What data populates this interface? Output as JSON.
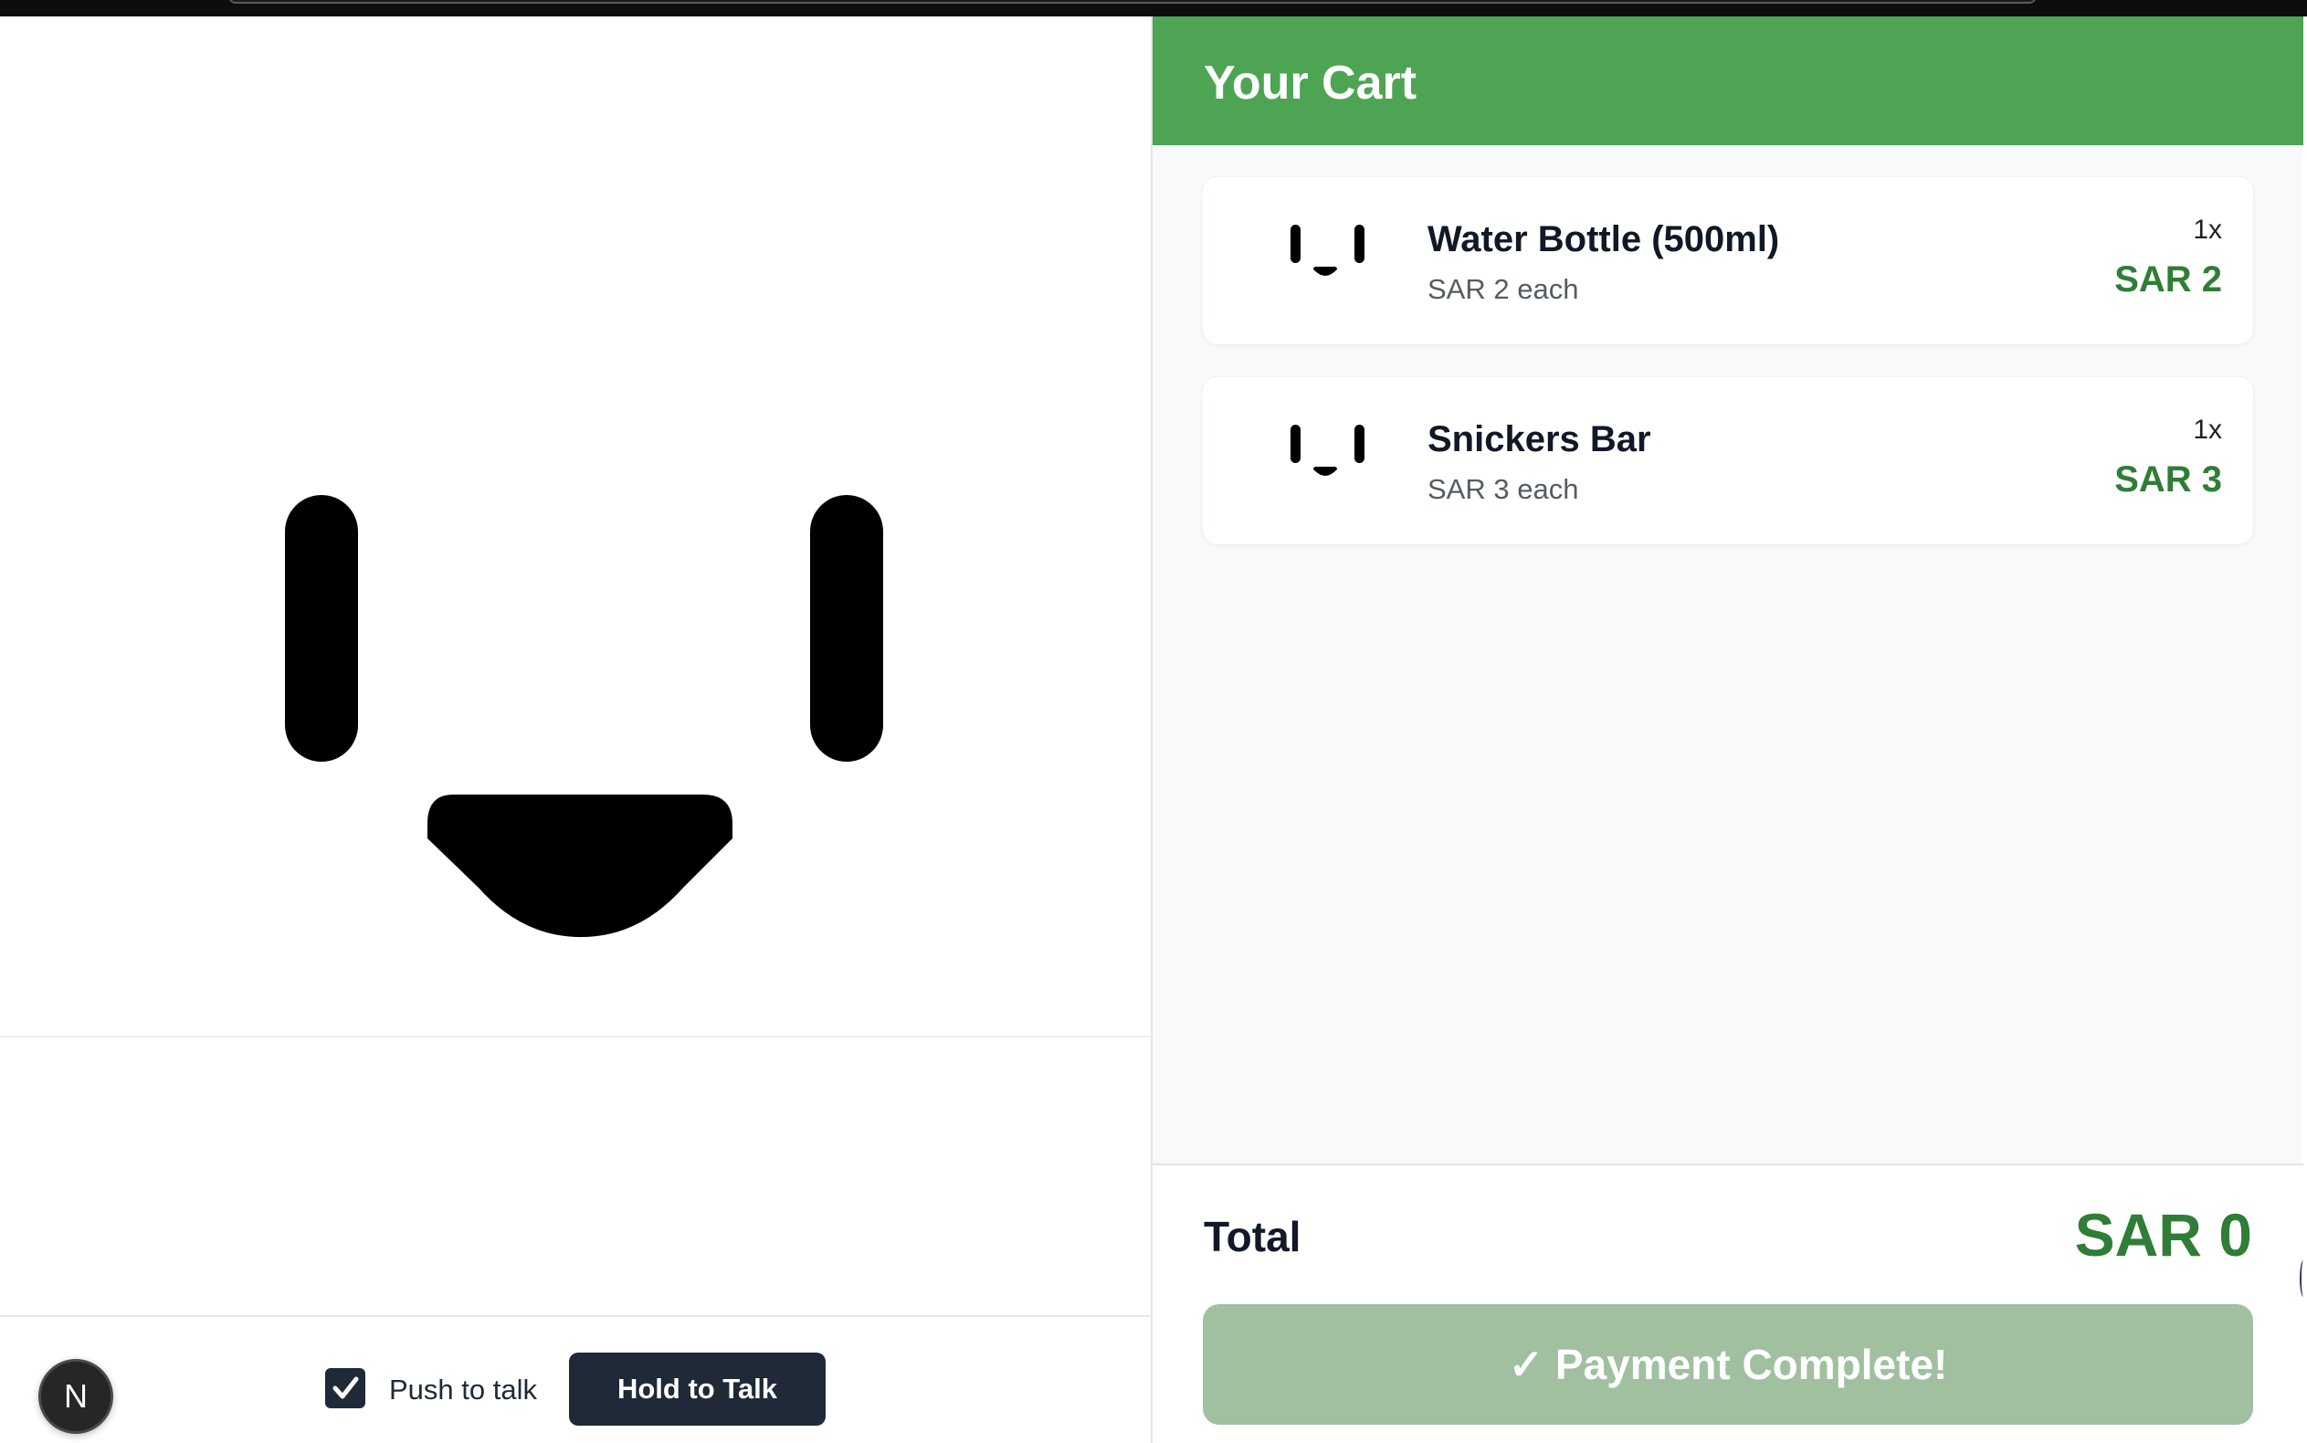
{
  "bottom_bar": {
    "avatar_initial": "N",
    "push_to_talk_label": "Push to talk",
    "push_to_talk_checked": true,
    "hold_button_label": "Hold to Talk"
  },
  "cart": {
    "title": "Your Cart",
    "items": [
      {
        "name": "Water Bottle (500ml)",
        "unit_price": "SAR 2 each",
        "quantity": "1x",
        "line_total": "SAR 2"
      },
      {
        "name": "Snickers Bar",
        "unit_price": "SAR 3 each",
        "quantity": "1x",
        "line_total": "SAR 3"
      }
    ],
    "total_label": "Total",
    "total_value": "SAR 0",
    "payment_button_label": "✓ Payment Complete!"
  },
  "colors": {
    "header_green": "#4da453",
    "price_green": "#2f7d36",
    "payment_button": "#a0c0a0",
    "dark_button": "#1f2937"
  }
}
